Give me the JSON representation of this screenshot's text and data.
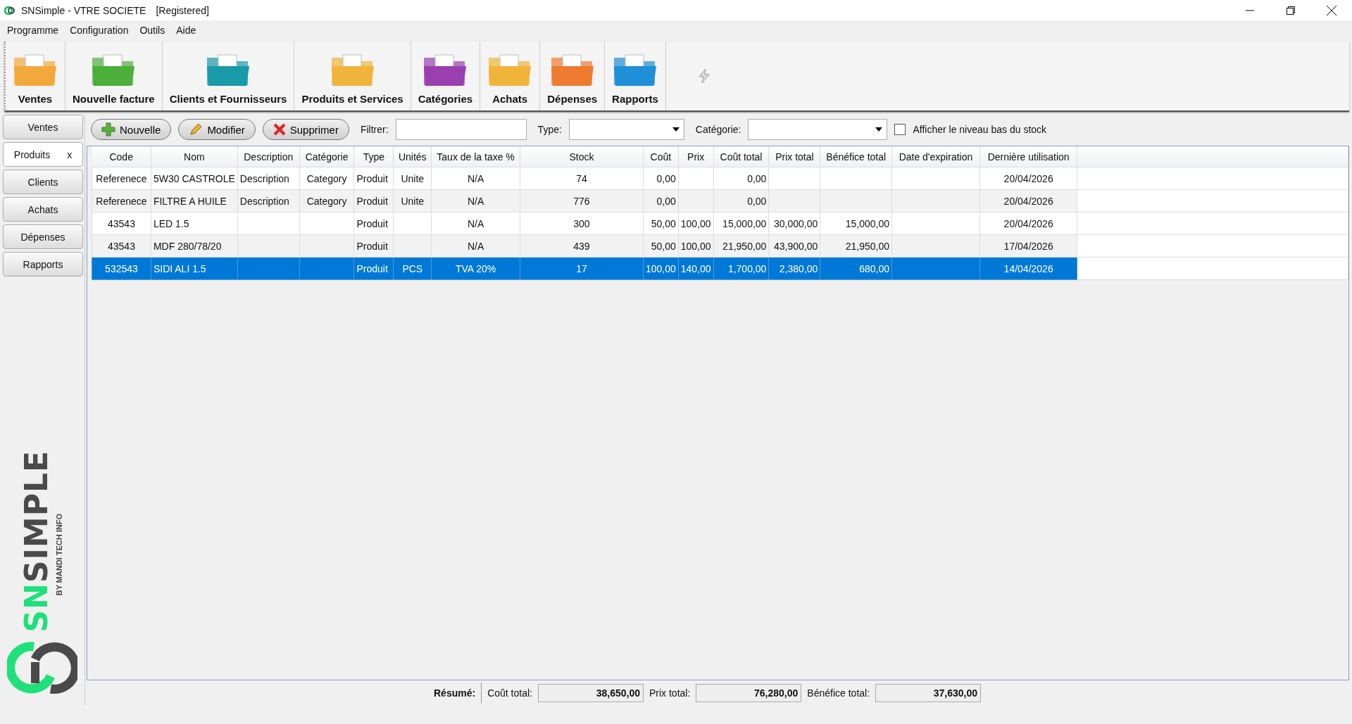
{
  "window": {
    "title": "SNSimple - VTRE SOCIETE",
    "status": "[Registered]"
  },
  "menu": [
    "Programme",
    "Configuration",
    "Outils",
    "Aide"
  ],
  "toolbar": [
    {
      "label": "Ventes",
      "color": "#f2a93b"
    },
    {
      "label": "Nouvelle facture",
      "color": "#4caf3c"
    },
    {
      "label": "Clients et Fournisseurs",
      "color": "#1a9aa8"
    },
    {
      "label": "Produits et Services",
      "color": "#f0b43a"
    },
    {
      "label": "Catégories",
      "color": "#9b3fb0"
    },
    {
      "label": "Achats",
      "color": "#f0b43a"
    },
    {
      "label": "Dépenses",
      "color": "#ef7b30"
    },
    {
      "label": "Rapports",
      "color": "#1f8fd8"
    }
  ],
  "side_tabs": [
    {
      "label": "Ventes",
      "selected": false
    },
    {
      "label": "Produits",
      "selected": true,
      "close": "x"
    },
    {
      "label": "Clients",
      "selected": false
    },
    {
      "label": "Achats",
      "selected": false
    },
    {
      "label": "Dépenses",
      "selected": false
    },
    {
      "label": "Rapports",
      "selected": false
    }
  ],
  "logo": {
    "brand_a": "SN",
    "brand_b": "SIMPLE",
    "tagline": "BY MANDI TECH INFO"
  },
  "actions": [
    {
      "label": "Nouvelle",
      "kind": "add"
    },
    {
      "label": "Modifier",
      "kind": "edit"
    },
    {
      "label": "Supprimer",
      "kind": "delete"
    }
  ],
  "filters": {
    "filter_label": "Filtrer:",
    "type_label": "Type:",
    "category_label": "Catégorie:",
    "low_stock": {
      "label": "Afficher le niveau bas du stock",
      "checked": false
    }
  },
  "table": {
    "columns": [
      "Code",
      "Nom",
      "Description",
      "Catégorie",
      "Type",
      "Unités",
      "Taux de la taxe %",
      "Stock",
      "Coût",
      "Prix",
      "Coût total",
      "Prix total",
      "Bénéfice total",
      "Date d'expiration",
      "Dernière utilisation"
    ],
    "rows": [
      {
        "selected": false,
        "cells": [
          "Referenece",
          "5W30 CASTROLE",
          "Description",
          "Category",
          "Produit",
          "Unite",
          "N/A",
          "74",
          "0,00",
          "",
          "0,00",
          "",
          "",
          "",
          "20/04/2026"
        ]
      },
      {
        "selected": false,
        "cells": [
          "Referenece",
          "FILTRE A HUILE",
          "Description",
          "Category",
          "Produit",
          "Unite",
          "N/A",
          "776",
          "0,00",
          "",
          "0,00",
          "",
          "",
          "",
          "20/04/2026"
        ]
      },
      {
        "selected": false,
        "cells": [
          "43543",
          "LED 1.5",
          "",
          "",
          "Produit",
          "",
          "N/A",
          "300",
          "50,00",
          "100,00",
          "15,000,00",
          "30,000,00",
          "15,000,00",
          "",
          "20/04/2026"
        ]
      },
      {
        "selected": false,
        "cells": [
          "43543",
          "MDF 280/78/20",
          "",
          "",
          "Produit",
          "",
          "N/A",
          "439",
          "50,00",
          "100,00",
          "21,950,00",
          "43,900,00",
          "21,950,00",
          "",
          "17/04/2026"
        ]
      },
      {
        "selected": true,
        "cells": [
          "532543",
          "SIDI ALI 1.5",
          "",
          "",
          "Produit",
          "PCS",
          "TVA  20%",
          "17",
          "100,00",
          "140,00",
          "1,700,00",
          "2,380,00",
          "680,00",
          "",
          "14/04/2026"
        ]
      }
    ]
  },
  "summary": {
    "title": "Résumé:",
    "items": [
      {
        "label": "Coût total:",
        "value": "38,650,00"
      },
      {
        "label": "Prix total:",
        "value": "76,280,00"
      },
      {
        "label": "Bénéfice total:",
        "value": "37,630,00"
      }
    ]
  }
}
